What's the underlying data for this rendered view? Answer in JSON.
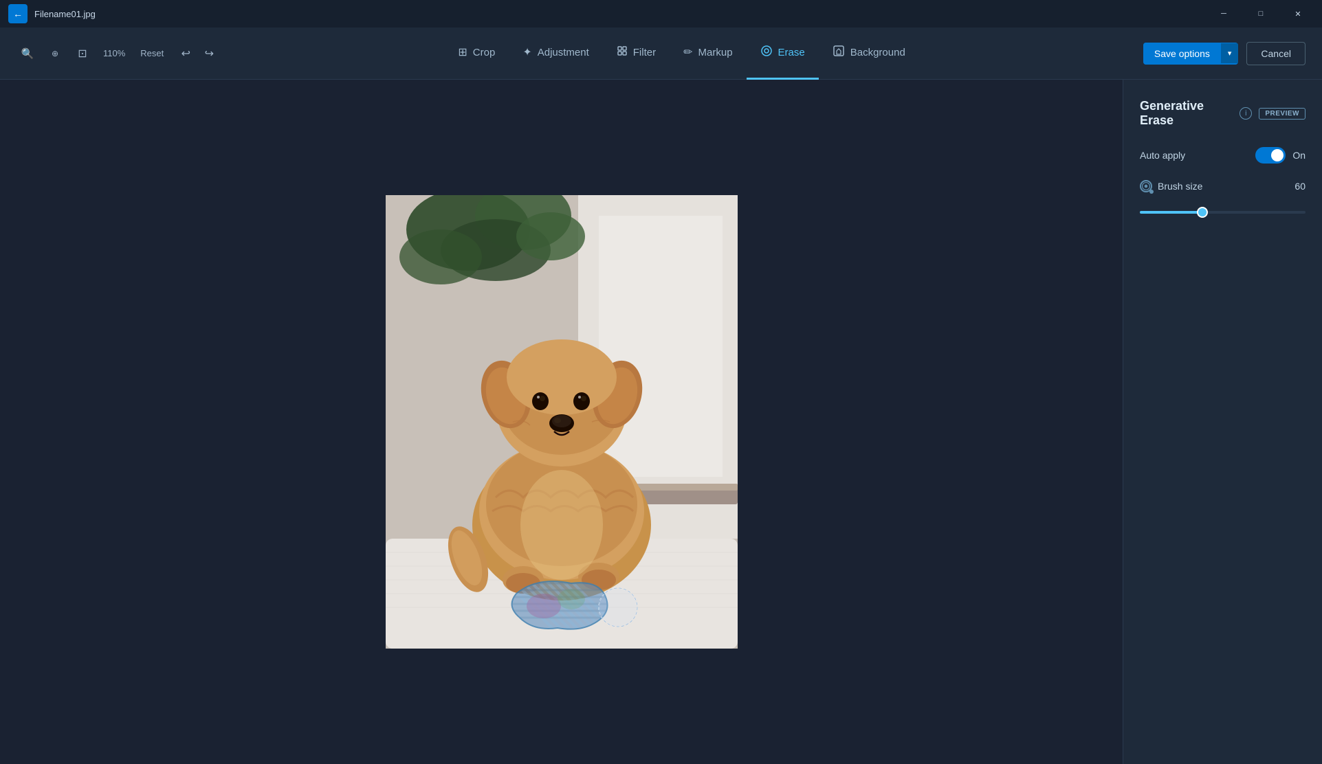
{
  "titleBar": {
    "filename": "Filename01.jpg",
    "backIcon": "←",
    "windowControls": {
      "minimize": "─",
      "maximize": "□",
      "close": "✕"
    }
  },
  "toolbar": {
    "zoomOut": "🔍",
    "zoomIn": "🔍",
    "fitScreen": "⊡",
    "zoomLevel": "110%",
    "reset": "Reset",
    "undoIcon": "↩",
    "redoIcon": "↪",
    "tabs": [
      {
        "id": "crop",
        "label": "Crop",
        "icon": "⊞",
        "active": false
      },
      {
        "id": "adjustment",
        "label": "Adjustment",
        "icon": "✦",
        "active": false
      },
      {
        "id": "filter",
        "label": "Filter",
        "icon": "⧖",
        "active": false
      },
      {
        "id": "markup",
        "label": "Markup",
        "icon": "✏",
        "active": false
      },
      {
        "id": "erase",
        "label": "Erase",
        "icon": "◌",
        "active": true
      },
      {
        "id": "background",
        "label": "Background",
        "icon": "⊡",
        "active": false
      }
    ],
    "saveOptions": "Save options",
    "saveArrow": "▾",
    "cancel": "Cancel"
  },
  "rightPanel": {
    "title": "Generative Erase",
    "infoIcon": "i",
    "previewBadge": "PREVIEW",
    "autoApplyLabel": "Auto apply",
    "toggleState": "On",
    "brushSizeLabel": "Brush size",
    "brushSizeValue": "60",
    "sliderMin": 0,
    "sliderMax": 100,
    "sliderValue": 37
  }
}
